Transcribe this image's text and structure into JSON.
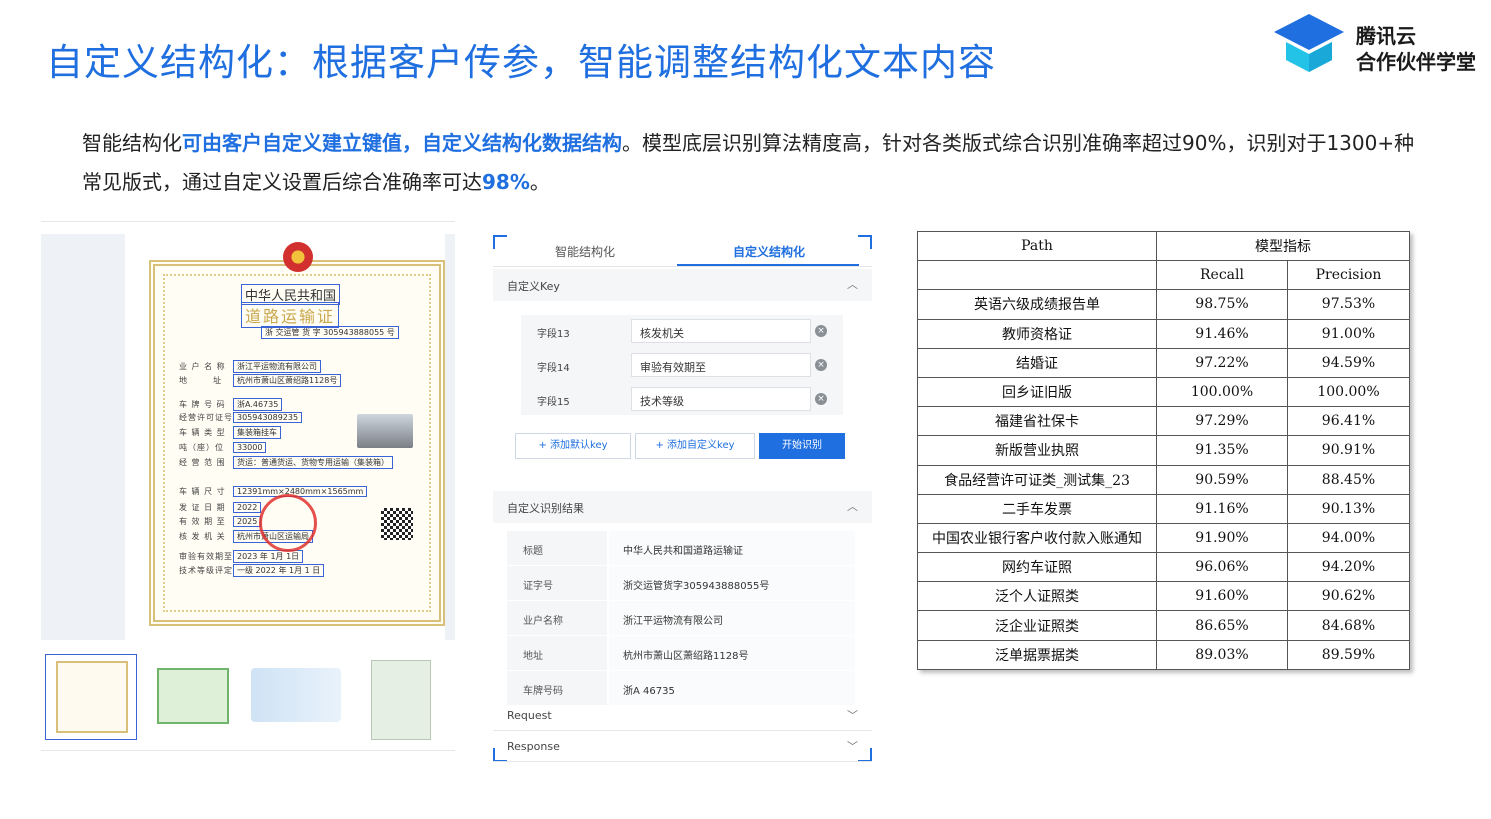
{
  "header": {
    "title": "自定义结构化：根据客户传参，智能调整结构化文本内容",
    "logo_line1": "腾讯云",
    "logo_line2": "合作伙伴学堂"
  },
  "description": {
    "part1": "智能结构化",
    "part2_highlight": "可由客户自定义建立键值，自定义结构化数据结构",
    "part3": "。模型底层识别算法精度高，针对各类版式综合识别准确率超过90%，识别对于1300+种常见版式，通过自定义设置后综合准确率可达",
    "part4_highlight": "98%",
    "part5": "。"
  },
  "document": {
    "cert_title1": "中华人民共和国",
    "cert_title2": "道路运输证",
    "cert_number": "浙 交运管 货 字 305943888055 号",
    "rows": [
      {
        "label": "业 户 名 称",
        "value": "浙江平运物流有限公司"
      },
      {
        "label": "地 　　 址",
        "value": "杭州市萧山区萧绍路1128号"
      },
      {
        "label": "车 牌 号 码",
        "value": "浙A.46735"
      },
      {
        "label": "经营许可证号",
        "value": "305943089235"
      },
      {
        "label": "车 辆 类 型",
        "value": "集装箱挂车"
      },
      {
        "label": "吨（座）位",
        "value": "33000"
      },
      {
        "label": "经 营 范 围",
        "value": "货运：普通货运、货物专用运输（集装箱）"
      },
      {
        "label": "车 辆 尺 寸",
        "value": "12391mm×2480mm×1565mm"
      },
      {
        "label": "发 证 日 期",
        "value": "2022"
      },
      {
        "label": "有 效 期 至",
        "value": "2025"
      },
      {
        "label": "核 发 机 关",
        "value": "杭州市萧山区运输局"
      },
      {
        "label": "审验有效期至",
        "value": "2023 年 1月 1日"
      },
      {
        "label": "技术等级评定",
        "value": "一级 2022 年 1月 1 日"
      }
    ]
  },
  "panel": {
    "tabs": [
      "智能结构化",
      "自定义结构化"
    ],
    "key_section_title": "自定义Key",
    "key_rows": [
      {
        "key": "字段13",
        "value": "核发机关"
      },
      {
        "key": "字段14",
        "value": "审验有效期至"
      },
      {
        "key": "字段15",
        "value": "技术等级"
      }
    ],
    "btn_add_default": "+ 添加默认key",
    "btn_add_custom": "+ 添加自定义key",
    "btn_start": "开始识别",
    "result_section_title": "自定义识别结果",
    "results": [
      {
        "key": "标题",
        "value": "中华人民共和国道路运输证"
      },
      {
        "key": "证字号",
        "value": "浙交运管货字305943888055号"
      },
      {
        "key": "业户名称",
        "value": "浙江平运物流有限公司"
      },
      {
        "key": "地址",
        "value": "杭州市萧山区萧绍路1128号"
      },
      {
        "key": "车牌号码",
        "value": "浙A 46735"
      }
    ],
    "request_label": "Request",
    "response_label": "Response"
  },
  "metrics_table": {
    "col_path": "Path",
    "col_group": "模型指标",
    "col_recall": "Recall",
    "col_precision": "Precision",
    "rows": [
      {
        "path": "英语六级成绩报告单",
        "recall": "98.75%",
        "precision": "97.53%"
      },
      {
        "path": "教师资格证",
        "recall": "91.46%",
        "precision": "91.00%"
      },
      {
        "path": "结婚证",
        "recall": "97.22%",
        "precision": "94.59%"
      },
      {
        "path": "回乡证旧版",
        "recall": "100.00%",
        "precision": "100.00%"
      },
      {
        "path": "福建省社保卡",
        "recall": "97.29%",
        "precision": "96.41%"
      },
      {
        "path": "新版营业执照",
        "recall": "91.35%",
        "precision": "90.91%"
      },
      {
        "path": "食品经营许可证类_测试集_23",
        "recall": "90.59%",
        "precision": "88.45%"
      },
      {
        "path": "二手车发票",
        "recall": "91.16%",
        "precision": "90.13%"
      },
      {
        "path": "中国农业银行客户收付款入账通知",
        "recall": "91.90%",
        "precision": "94.00%"
      },
      {
        "path": "网约车证照",
        "recall": "96.06%",
        "precision": "94.20%"
      },
      {
        "path": "泛个人证照类",
        "recall": "91.60%",
        "precision": "90.62%"
      },
      {
        "path": "泛企业证照类",
        "recall": "86.65%",
        "precision": "84.68%"
      },
      {
        "path": "泛单据票据类",
        "recall": "89.03%",
        "precision": "89.59%"
      }
    ]
  }
}
